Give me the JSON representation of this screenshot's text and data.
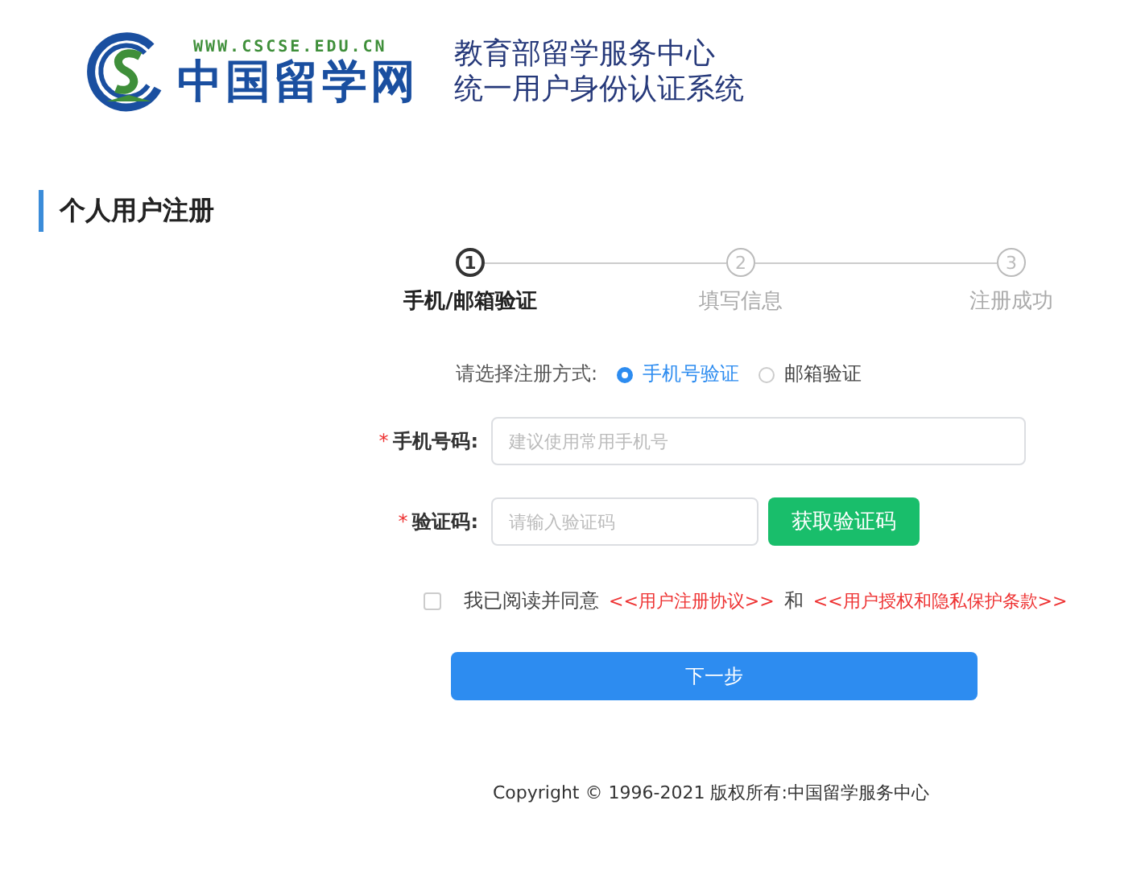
{
  "header": {
    "logo_url": "WWW.CSCSE.EDU.CN",
    "logo_name": "中国留学网",
    "title_lines": [
      "教育部留学服务中心",
      "统一用户身份认证系统"
    ]
  },
  "section_title": "个人用户注册",
  "steps": [
    {
      "number": "1",
      "label": "手机/邮箱验证",
      "selected": true
    },
    {
      "number": "2",
      "label": "填写信息",
      "selected": false
    },
    {
      "number": "3",
      "label": "注册成功",
      "selected": false
    }
  ],
  "method": {
    "label": "请选择注册方式:",
    "options": [
      {
        "label": "手机号验证",
        "selected": true
      },
      {
        "label": "邮箱验证",
        "selected": false
      }
    ]
  },
  "fields": [
    {
      "label": "手机号码:",
      "required_mark": "*",
      "placeholder": "建议使用常用手机号"
    },
    {
      "label": "验证码:",
      "required_mark": "*",
      "placeholder": "请输入验证码",
      "button": "获取验证码"
    }
  ],
  "agreement": {
    "checked": false,
    "text": "我已阅读并同意",
    "links": [
      "<<用户注册协议>>",
      "<<用户授权和隐私保护条款>>"
    ],
    "joiner": "和"
  },
  "next_button": "下一步",
  "footer": "Copyright © 1996-2021 版权所有:中国留学服务中心"
}
